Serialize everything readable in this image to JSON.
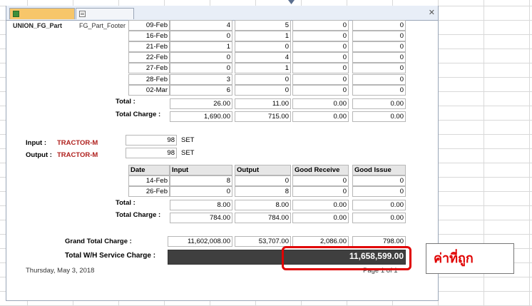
{
  "tabs": [
    {
      "label": "UNION_FG_Part",
      "icon": "table-icon"
    },
    {
      "label": "FG_Part_Footer",
      "icon": "form-icon"
    }
  ],
  "section1": {
    "rows": [
      {
        "date": "09-Feb",
        "input": "4",
        "output": "5",
        "good_receive": "0",
        "good_issue": "0"
      },
      {
        "date": "16-Feb",
        "input": "0",
        "output": "1",
        "good_receive": "0",
        "good_issue": "0"
      },
      {
        "date": "21-Feb",
        "input": "1",
        "output": "0",
        "good_receive": "0",
        "good_issue": "0"
      },
      {
        "date": "22-Feb",
        "input": "0",
        "output": "4",
        "good_receive": "0",
        "good_issue": "0"
      },
      {
        "date": "27-Feb",
        "input": "0",
        "output": "1",
        "good_receive": "0",
        "good_issue": "0"
      },
      {
        "date": "28-Feb",
        "input": "3",
        "output": "0",
        "good_receive": "0",
        "good_issue": "0"
      },
      {
        "date": "02-Mar",
        "input": "6",
        "output": "0",
        "good_receive": "0",
        "good_issue": "0"
      }
    ],
    "total_label": "Total :",
    "total": {
      "input": "26.00",
      "output": "11.00",
      "good_receive": "0.00",
      "good_issue": "0.00"
    },
    "charge_label": "Total Charge :",
    "charge": {
      "input": "1,690.00",
      "output": "715.00",
      "good_receive": "0.00",
      "good_issue": "0.00"
    }
  },
  "section2": {
    "input_label": "Input :",
    "output_label": "Output :",
    "part_input": "TRACTOR-M",
    "part_output": "TRACTOR-M",
    "input_qty": "98",
    "output_qty": "98",
    "unit_input": "SET",
    "unit_output": "SET",
    "headers": {
      "date": "Date",
      "input": "Input",
      "output": "Output",
      "good_receive": "Good Receive",
      "good_issue": "Good Issue"
    },
    "rows": [
      {
        "date": "14-Feb",
        "input": "8",
        "output": "0",
        "good_receive": "0",
        "good_issue": "0"
      },
      {
        "date": "26-Feb",
        "input": "0",
        "output": "8",
        "good_receive": "0",
        "good_issue": "0"
      }
    ],
    "total_label": "Total :",
    "total": {
      "input": "8.00",
      "output": "8.00",
      "good_receive": "0.00",
      "good_issue": "0.00"
    },
    "charge_label": "Total Charge :",
    "charge": {
      "input": "784.00",
      "output": "784.00",
      "good_receive": "0.00",
      "good_issue": "0.00"
    }
  },
  "grand": {
    "label": "Grand Total Charge :",
    "input": "11,602,008.00",
    "output": "53,707.00",
    "good_receive": "2,086.00",
    "good_issue": "798.00"
  },
  "service": {
    "label": "Total W/H Service Charge :",
    "value": "11,658,599.00"
  },
  "footer": {
    "date": "Thursday, May 3, 2018",
    "page": "Page 1 of 1"
  },
  "annotation": {
    "text": "ค่าที่ถูก",
    "color": "#e00000"
  },
  "colors": {
    "accent_tab": "#f7c66a",
    "part_name": "#b0211e",
    "dark_bar": "#3f3f3f"
  }
}
